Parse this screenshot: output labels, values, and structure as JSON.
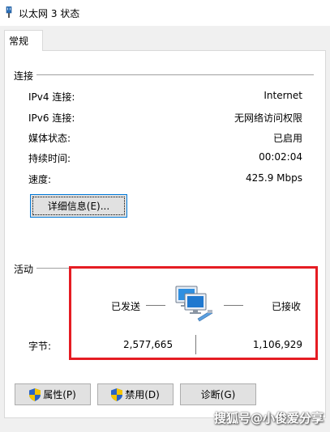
{
  "window": {
    "title": "以太网 3 状态"
  },
  "tabs": [
    {
      "label": "常规"
    }
  ],
  "connection": {
    "section_title": "连接",
    "rows": [
      {
        "label": "IPv4 连接:",
        "value": "Internet"
      },
      {
        "label": "IPv6 连接:",
        "value": "无网络访问权限"
      },
      {
        "label": "媒体状态:",
        "value": "已启用"
      },
      {
        "label": "持续时间:",
        "value": "00:02:04"
      },
      {
        "label": "速度:",
        "value": "425.9 Mbps"
      }
    ],
    "details_button": "详细信息(E)..."
  },
  "activity": {
    "section_title": "活动",
    "sent_label": "已发送",
    "received_label": "已接收",
    "bytes_label": "字节:",
    "bytes_sent": "2,577,665",
    "bytes_received": "1,106,929"
  },
  "buttons": {
    "properties": "属性(P)",
    "disable": "禁用(D)",
    "diagnose": "诊断(G)"
  },
  "watermark": "搜狐号@小俊爱分享",
  "colors": {
    "highlight": "#e51c23",
    "focus_border": "#0078d7"
  },
  "icons": {
    "title": "ethernet-connector-icon",
    "activity": "network-computers-icon",
    "uac": "uac-shield-icon"
  }
}
